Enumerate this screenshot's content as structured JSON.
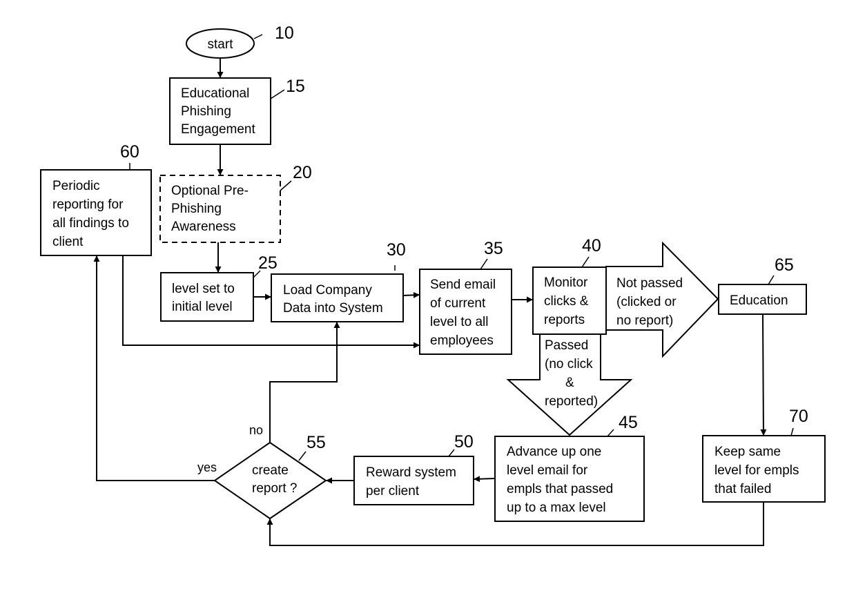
{
  "diagram": {
    "nodes": {
      "n10": {
        "ref": "10",
        "lines": [
          "start"
        ]
      },
      "n15": {
        "ref": "15",
        "lines": [
          "Educational",
          "Phishing",
          "Engagement"
        ]
      },
      "n20": {
        "ref": "20",
        "lines": [
          "Optional Pre-",
          "Phishing",
          "Awareness"
        ]
      },
      "n25": {
        "ref": "25",
        "lines": [
          "level set to",
          "initial level"
        ]
      },
      "n30": {
        "ref": "30",
        "lines": [
          "Load Company",
          "Data into System"
        ]
      },
      "n35": {
        "ref": "35",
        "lines": [
          "Send email",
          "of current",
          "level to all",
          "employees"
        ]
      },
      "n40": {
        "ref": "40",
        "lines": [
          "Monitor",
          "clicks &",
          "reports"
        ]
      },
      "n45": {
        "ref": "45",
        "lines": [
          "Advance up one",
          "level email for",
          "empls that passed",
          "up to a max level"
        ]
      },
      "n50": {
        "ref": "50",
        "lines": [
          "Reward system",
          "per client"
        ]
      },
      "n55": {
        "ref": "55",
        "lines": [
          "create",
          "report ?"
        ]
      },
      "n60": {
        "ref": "60",
        "lines": [
          "Periodic",
          "reporting for",
          "all findings to",
          "client"
        ]
      },
      "n65": {
        "ref": "65",
        "lines": [
          "Education"
        ]
      },
      "n70": {
        "ref": "70",
        "lines": [
          "Keep same",
          "level for empls",
          "that failed"
        ]
      }
    },
    "branches": {
      "not_passed": [
        "Not passed",
        "(clicked or",
        "no report)"
      ],
      "passed": [
        "Passed",
        "(no click",
        "&",
        "reported)"
      ],
      "yes": "yes",
      "no": "no"
    }
  }
}
